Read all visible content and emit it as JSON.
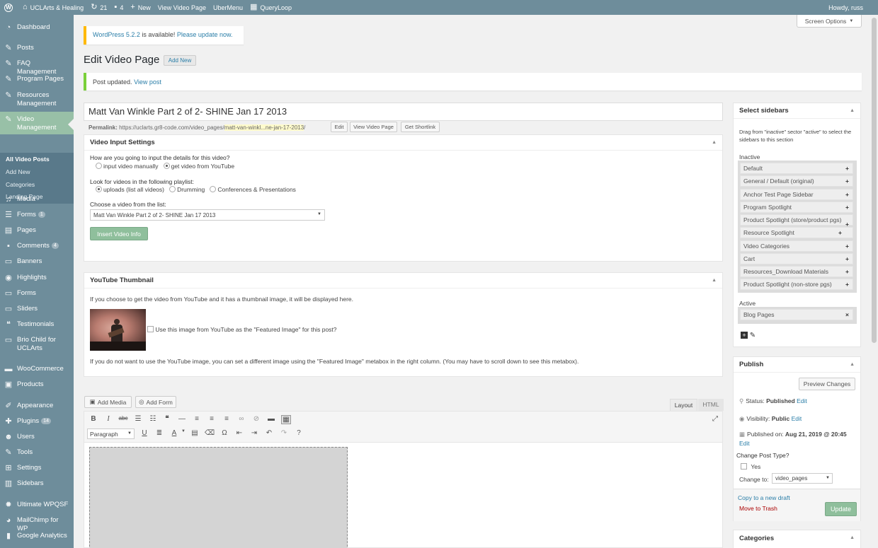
{
  "admin_bar": {
    "site_name": "UCLArts & Healing",
    "updates_count": "21",
    "comments_count": "4",
    "new_label": "New",
    "view_page": "View Video Page",
    "ubermenu": "UberMenu",
    "queryloop": "QueryLoop",
    "howdy": "Howdy, russ"
  },
  "menu": {
    "dashboard": "Dashboard",
    "posts": "Posts",
    "faq": "FAQ Management",
    "program_pages": "Program Pages",
    "resources": "Resources Management",
    "video": "Video Management",
    "sub": [
      "All Video Posts",
      "Add New",
      "Categories",
      "Landing Page"
    ],
    "media": "Media",
    "forms": "Forms",
    "forms_badge": "1",
    "pages": "Pages",
    "comments": "Comments",
    "comments_badge": "4",
    "banners": "Banners",
    "highlights": "Highlights",
    "forms2": "Forms",
    "sliders": "Sliders",
    "testimonials": "Testimonials",
    "brio": "Brio Child for UCLArts",
    "woocommerce": "WooCommerce",
    "products": "Products",
    "appearance": "Appearance",
    "plugins": "Plugins",
    "plugins_badge": "14",
    "users": "Users",
    "tools": "Tools",
    "settings": "Settings",
    "sidebars": "Sidebars",
    "ultimate": "Ultimate WPQSF",
    "mailchimp": "MailChimp for WP",
    "analytics": "Google Analytics"
  },
  "screen_options": "Screen Options",
  "update_notice": {
    "version": "WordPress 5.2.2",
    "middle": " is available! ",
    "link": "Please update now."
  },
  "page_title": "Edit Video Page",
  "add_new": "Add New",
  "post_updated": {
    "text": "Post updated.",
    "link": "View post"
  },
  "post_title": "Matt Van Winkle Part 2 of 2- SHINE Jan 17 2013",
  "permalink": {
    "label": "Permalink:",
    "base": "https://uclarts.gr8-code.com/video_pages/",
    "slug": "matt-van-winkl...ne-jan-17-2013",
    "trail": "/",
    "edit": "Edit",
    "view": "View Video Page",
    "shortlink": "Get Shortlink"
  },
  "video_input": {
    "title": "Video Input Settings",
    "q1": "How are you going to input the details for this video?",
    "opt_manual": "input video manually",
    "opt_youtube": "get video from YouTube",
    "q2": "Look for videos in the following playlist:",
    "pl_uploads": "uploads (list all videos)",
    "pl_drumming": "Drumming",
    "pl_conf": "Conferences & Presentations",
    "q3": "Choose a video from the list:",
    "selected_video": "Matt Van Winkle Part 2 of 2- SHINE Jan 17 2013",
    "insert_btn": "Insert Video Info"
  },
  "youtube_thumb": {
    "title": "YouTube Thumbnail",
    "desc": "If you choose to get the video from YouTube and it has a thumbnail image, it will be displayed here.",
    "use_image": "Use this image from YouTube as the \"Featured Image\" for this post?",
    "note": "If you do not want to use the YouTube image, you can set a different image using the \"Featured Image\" metabox in the right column. (You may have to scroll down to see this metabox)."
  },
  "editor": {
    "add_media": "Add Media",
    "add_form": "Add Form",
    "tab_layout": "Layout",
    "tab_html": "HTML",
    "format": "Paragraph"
  },
  "sidebars_box": {
    "title": "Select sidebars",
    "instructions": "Drag from \"inactive\" sector \"active\" to select the sidebars to this section",
    "inactive_label": "Inactive",
    "inactive": [
      "Default",
      "General / Default (original)",
      "Anchor Test Page Sidebar",
      "Program Spotlight",
      "Product Spotlight (store/product pgs)",
      "Resource Spotlight",
      "Video Categories",
      "Cart",
      "Resources_Download Materials",
      "Product Spotlight (non-store pgs)"
    ],
    "active_label": "Active",
    "active": [
      "Blog Pages"
    ]
  },
  "publish": {
    "title": "Publish",
    "preview": "Preview Changes",
    "status_label": "Status: ",
    "status": "Published",
    "status_edit": "Edit",
    "visibility_label": "Visibility: ",
    "visibility": "Public",
    "visibility_edit": "Edit",
    "published_label": "Published on: ",
    "published": "Aug 21, 2019 @ 20:45",
    "published_edit": "Edit",
    "change_type": "Change Post Type?",
    "yes": "Yes",
    "change_to": "Change to:",
    "type_value": "video_pages",
    "copy_draft": "Copy to a new draft",
    "trash": "Move to Trash",
    "update": "Update"
  },
  "categories": {
    "title": "Categories"
  }
}
